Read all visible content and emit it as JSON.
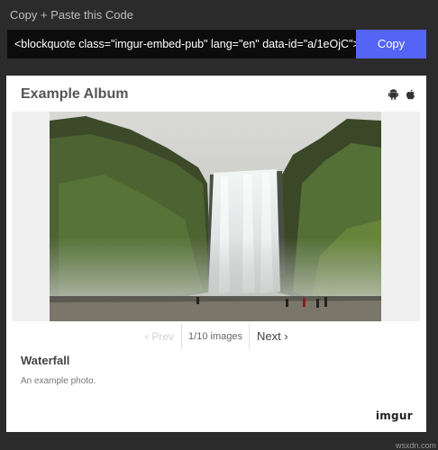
{
  "header": {
    "label": "Copy + Paste this Code"
  },
  "embed": {
    "code": "<blockquote class=\"imgur-embed-pub\" lang=\"en\" data-id=\"a/1eOjC\"><",
    "copy_label": "Copy"
  },
  "album": {
    "title": "Example Album",
    "icons": [
      "android-icon",
      "apple-icon"
    ],
    "pager": {
      "prev": "‹ Prev",
      "count": "1/10 images",
      "next": "Next ›"
    },
    "item_title": "Waterfall",
    "item_desc": "An example photo.",
    "brand": "imgur"
  },
  "watermark": "wsxdn.com",
  "colors": {
    "accent": "#5464f5",
    "background": "#2b2b2b",
    "code_bg": "#0c0c0c"
  }
}
